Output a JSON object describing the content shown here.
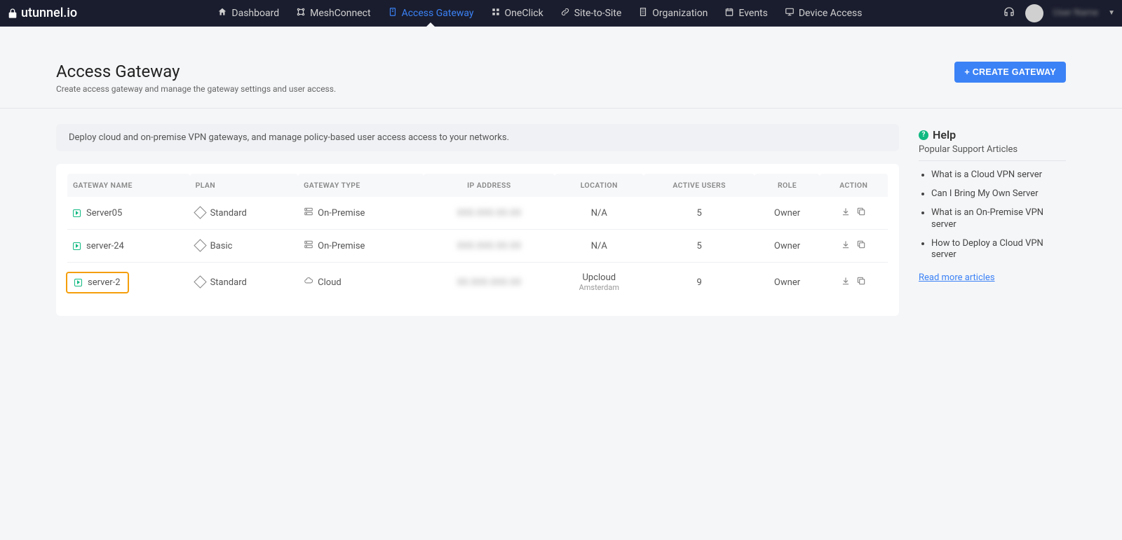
{
  "brand": "utunnel.io",
  "nav": {
    "items": [
      {
        "label": "Dashboard",
        "icon": "home"
      },
      {
        "label": "MeshConnect",
        "icon": "mesh"
      },
      {
        "label": "Access Gateway",
        "icon": "gateway",
        "active": true
      },
      {
        "label": "OneClick",
        "icon": "grid"
      },
      {
        "label": "Site-to-Site",
        "icon": "link"
      },
      {
        "label": "Organization",
        "icon": "building"
      },
      {
        "label": "Events",
        "icon": "calendar"
      },
      {
        "label": "Device Access",
        "icon": "monitor"
      }
    ]
  },
  "header": {
    "title": "Access Gateway",
    "subtitle": "Create access gateway and manage the gateway settings and user access.",
    "create_btn": "+ CREATE GATEWAY"
  },
  "banner": "Deploy cloud and on-premise VPN gateways, and manage policy-based user access access to your networks.",
  "table": {
    "cols": [
      "GATEWAY NAME",
      "PLAN",
      "GATEWAY TYPE",
      "IP ADDRESS",
      "LOCATION",
      "ACTIVE USERS",
      "ROLE",
      "ACTION"
    ],
    "rows": [
      {
        "name": "Server05",
        "plan": "Standard",
        "type": "On-Premise",
        "type_icon": "server",
        "ip": "XXX.XXX.XX.XX",
        "loc": "N/A",
        "loc_sub": "",
        "users": "5",
        "role": "Owner",
        "highlight": false
      },
      {
        "name": "server-24",
        "plan": "Basic",
        "type": "On-Premise",
        "type_icon": "server",
        "ip": "XXX.XXX.XX.XX",
        "loc": "N/A",
        "loc_sub": "",
        "users": "5",
        "role": "Owner",
        "highlight": false
      },
      {
        "name": "server-2",
        "plan": "Standard",
        "type": "Cloud",
        "type_icon": "cloud",
        "ip": "XX.XXX.XXX.XX",
        "loc": "Upcloud",
        "loc_sub": "Amsterdam",
        "users": "9",
        "role": "Owner",
        "highlight": true
      }
    ]
  },
  "help": {
    "title": "Help",
    "subtitle": "Popular Support Articles",
    "articles": [
      "What is a Cloud VPN server",
      "Can I Bring My Own Server",
      "What is an On-Premise VPN server",
      "How to Deploy a Cloud VPN server"
    ],
    "more": "Read more articles"
  }
}
